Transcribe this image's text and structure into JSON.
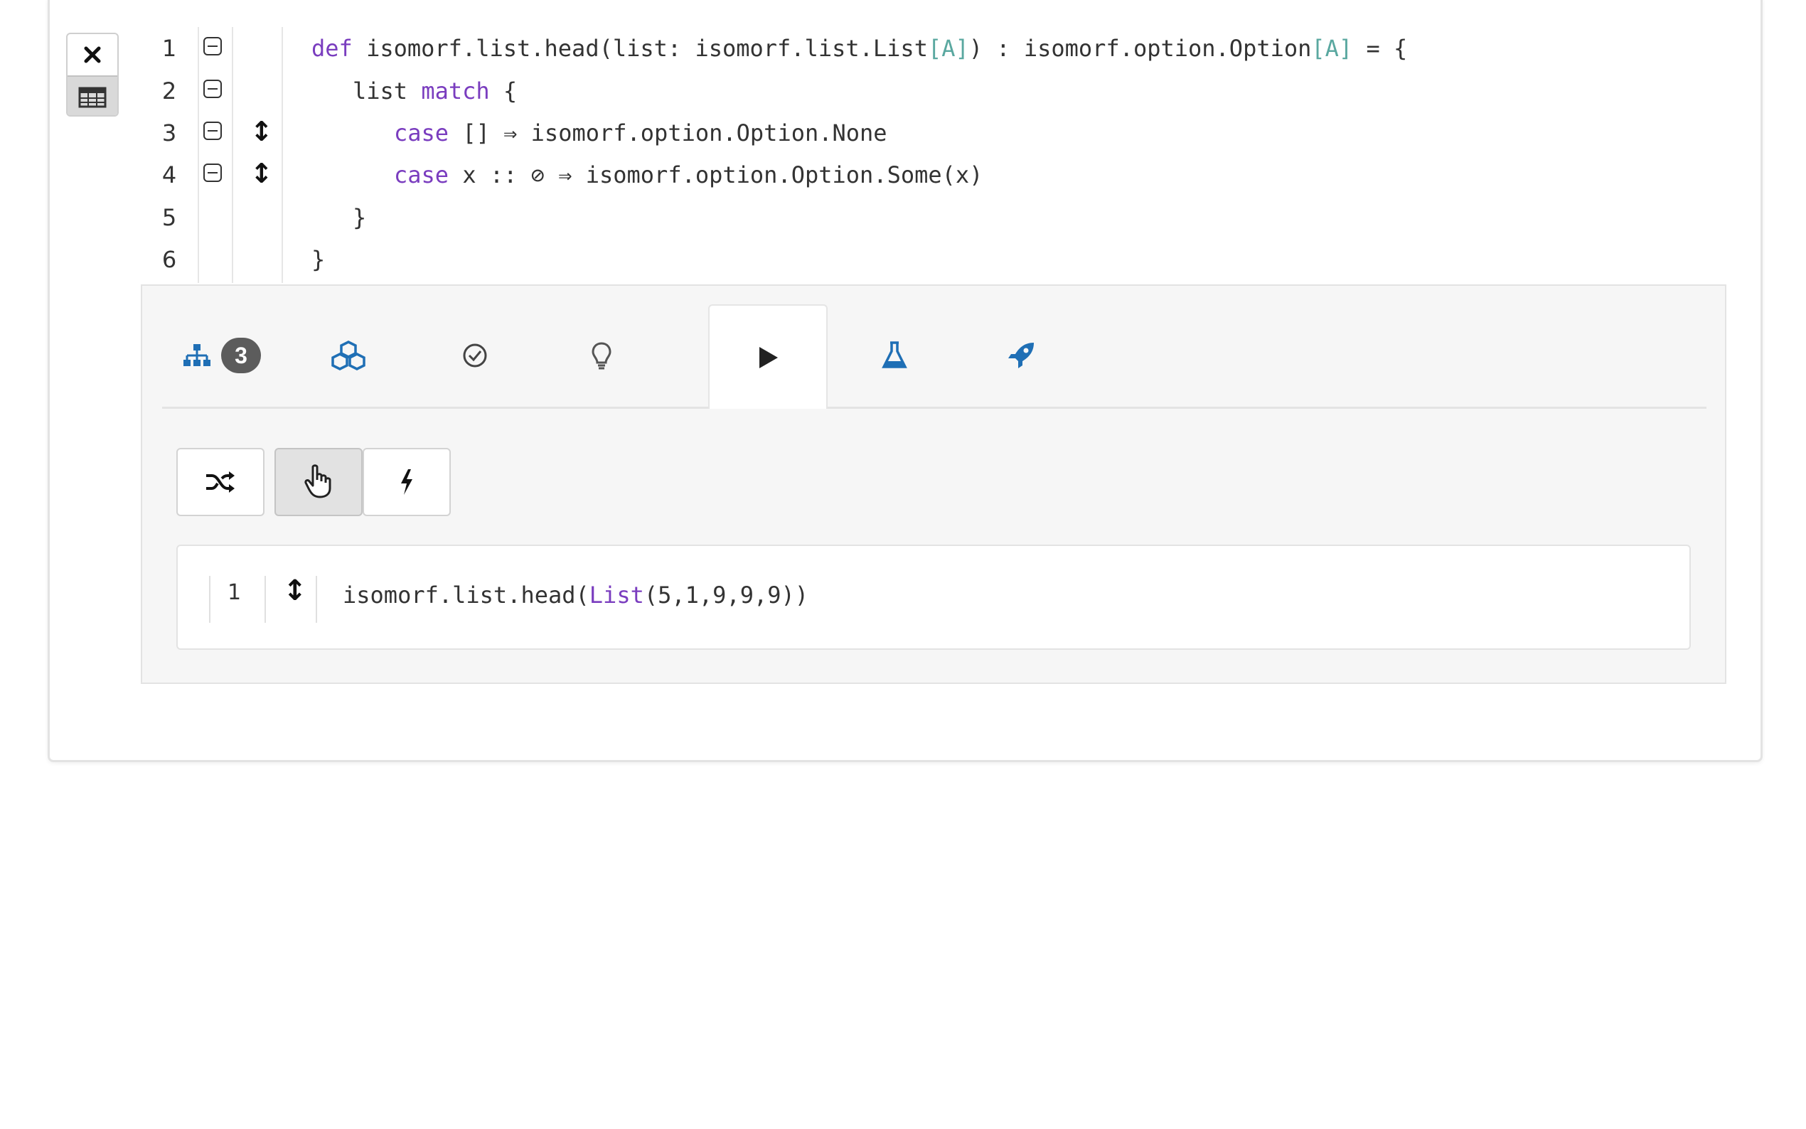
{
  "editor": {
    "lines": [
      {
        "num": "1",
        "tokens": [
          {
            "t": "def",
            "c": "kw"
          },
          {
            "t": " isomorf.list.head(list: isomorf.list.List",
            "c": "plain"
          },
          {
            "t": "[A]",
            "c": "tp"
          },
          {
            "t": ") : isomorf.option.Option",
            "c": "plain"
          },
          {
            "t": "[A]",
            "c": "tp"
          },
          {
            "t": " = {",
            "c": "plain"
          }
        ]
      },
      {
        "num": "2",
        "tokens": [
          {
            "t": "list ",
            "c": "plain"
          },
          {
            "t": "match",
            "c": "kw"
          },
          {
            "t": " {",
            "c": "plain"
          }
        ]
      },
      {
        "num": "3",
        "tokens": [
          {
            "t": "case",
            "c": "kw"
          },
          {
            "t": " [] ⇒ isomorf.option.Option.None",
            "c": "plain"
          }
        ]
      },
      {
        "num": "4",
        "tokens": [
          {
            "t": "case",
            "c": "kw"
          },
          {
            "t": " x :: ⊘ ⇒ isomorf.option.Option.Some(x)",
            "c": "plain"
          }
        ]
      },
      {
        "num": "5",
        "tokens": [
          {
            "t": "}",
            "c": "plain"
          }
        ]
      },
      {
        "num": "6",
        "tokens": [
          {
            "t": "}",
            "c": "plain"
          }
        ]
      }
    ]
  },
  "tabs": {
    "structure_badge": "3"
  },
  "repl": {
    "line_num": "1",
    "prefix": "isomorf.list.head(",
    "kw": "List",
    "suffix": "(5,1,9,9,9))"
  },
  "colors": {
    "accent_blue": "#1f6fb5",
    "keyword_purple": "#7a3dbf",
    "type_teal": "#5aa8a0"
  }
}
